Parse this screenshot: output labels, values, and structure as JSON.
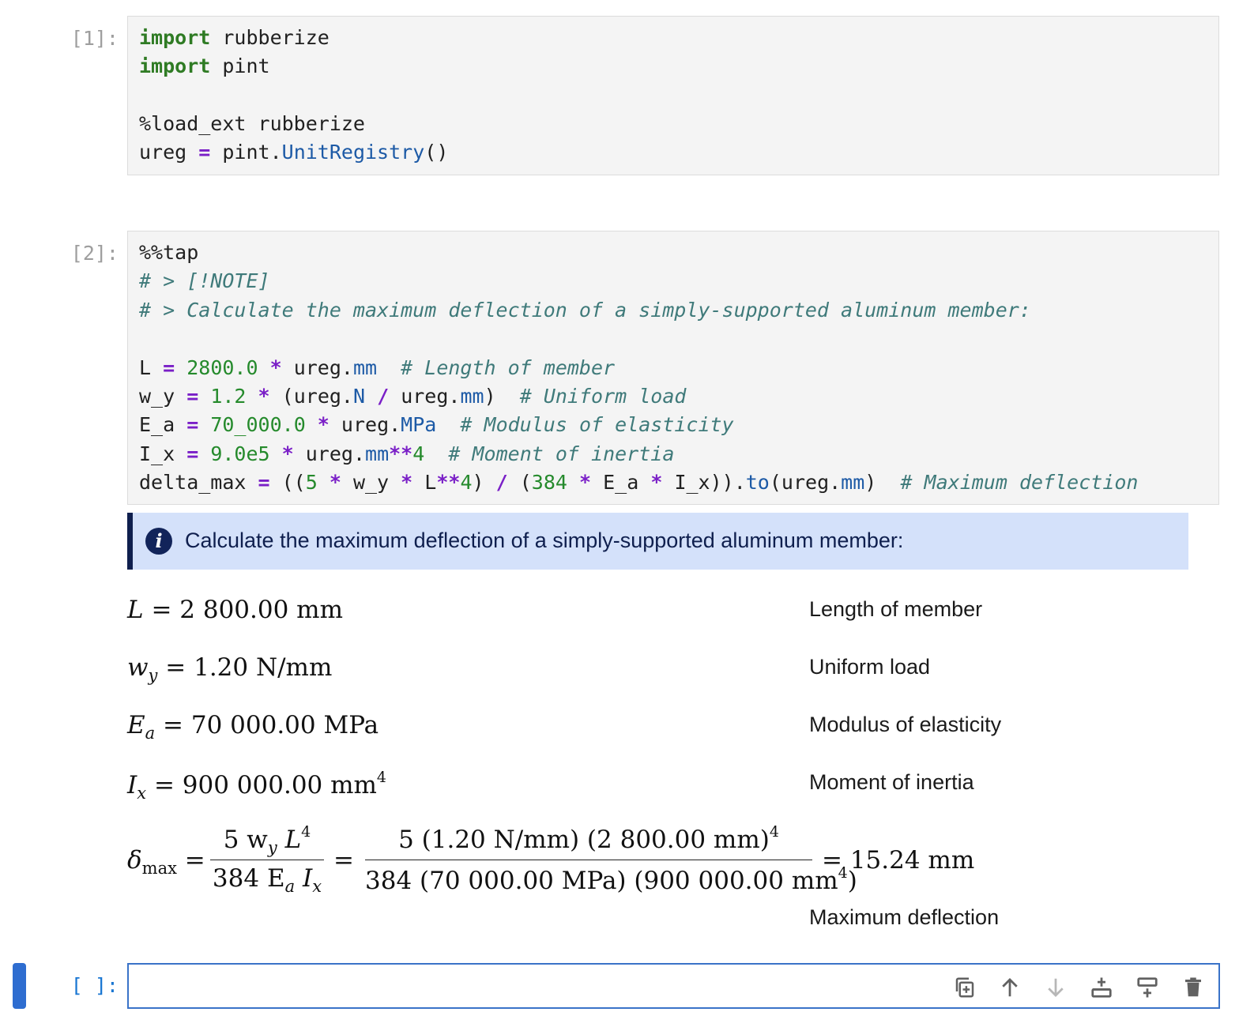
{
  "cell1": {
    "prompt": "[1]:",
    "lines": {
      "l1_kw": "import",
      "l1_rest": " rubberize",
      "l2_kw": "import",
      "l2_rest": " pint",
      "l3": "%load_ext rubberize",
      "l4_a": "ureg ",
      "l4_op": "=",
      "l4_b": " pint.",
      "l4_attr": "UnitRegistry",
      "l4_c": "()"
    }
  },
  "cell2": {
    "prompt": "[2]:",
    "magic": "%%tap",
    "note_cm": "# > [!NOTE]",
    "desc_cm": "# > Calculate the maximum deflection of a simply-supported aluminum member:",
    "L_line": {
      "a": "L ",
      "op": "=",
      "num": " 2800.0",
      "op2": " *",
      "b": " ureg.",
      "attr": "mm",
      "cm": "  # Length of member"
    },
    "wy_line": {
      "a": "w_y ",
      "op": "=",
      "num": " 1.2",
      "op2": " *",
      "b": " (ureg.",
      "attr": "N",
      "op3": " /",
      "c": " ureg.",
      "attr2": "mm",
      "d": ")",
      "cm": "  # Uniform load"
    },
    "Ea_line": {
      "a": "E_a ",
      "op": "=",
      "num": " 70_000.0",
      "op2": " *",
      "b": " ureg.",
      "attr": "MPa",
      "cm": "  # Modulus of elasticity"
    },
    "Ix_line": {
      "a": "I_x ",
      "op": "=",
      "num": " 9.0e5",
      "op2": " *",
      "b": " ureg.",
      "attr": "mm",
      "op3": "**",
      "num2": "4",
      "cm": "  # Moment of inertia"
    },
    "delta_line": {
      "a": "delta_max ",
      "op": "=",
      "b": " ((",
      "num": "5",
      "op2": " *",
      "c": " w_y ",
      "op3": "*",
      "d": " L",
      "op4": "**",
      "num2": "4",
      "e": ") ",
      "op5": "/",
      "f": " (",
      "num3": "384",
      "op6": " *",
      "g": " E_a ",
      "op7": "*",
      "h": " I_x)).",
      "attr": "to",
      "i": "(ureg.",
      "attr2": "mm",
      "j": ")",
      "cm": "  # Maximum deflection"
    }
  },
  "note": {
    "icon": "info-icon",
    "text": "Calculate the maximum deflection of a simply-supported aluminum member:",
    "accent": "#0f1f4e",
    "background": "#d4e1fa"
  },
  "results": {
    "L": {
      "sym": "L",
      "eq": " = 2 800.00 mm",
      "desc": "Length of member"
    },
    "wy": {
      "sym": "w",
      "sub": "y",
      "eq": " = 1.20 N/mm",
      "desc": "Uniform load"
    },
    "Ea": {
      "sym": "E",
      "sub": "a",
      "eq": " = 70 000.00 MPa",
      "desc": "Modulus of elasticity"
    },
    "Ix": {
      "sym": "I",
      "sub": "x",
      "eq": " = 900 000.00 mm",
      "sup": "4",
      "desc": "Moment of inertia"
    },
    "delta": {
      "sym": "δ",
      "sub": "max",
      "eq1": " =",
      "num1": "5 w",
      "num1_sub": "y",
      "num1_L": " L",
      "num1_sup": "4",
      "den1": "384 E",
      "den1_sub": "a",
      "den1_I": " I",
      "den1_sub2": "x",
      "eq2": "=",
      "num2": "5  (1.20 N/mm) (2 800.00 mm)",
      "num2_sup": "4",
      "den2": "384  (70 000.00 MPa)  (900 000.00 mm",
      "den2_sup": "4",
      "den2_end": ")",
      "result": "= 15.24 mm",
      "desc": "Maximum deflection"
    }
  },
  "cell3": {
    "prompt": "[ ]:",
    "toolbar": [
      "duplicate-icon",
      "move-up-icon",
      "move-down-icon",
      "insert-above-icon",
      "insert-below-icon",
      "delete-icon"
    ]
  }
}
